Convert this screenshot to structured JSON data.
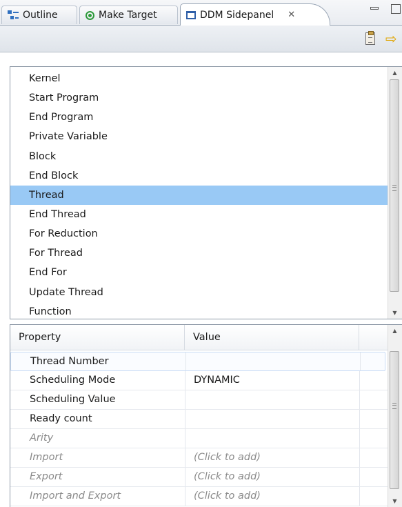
{
  "tabs": [
    {
      "label": "Outline",
      "icon": "outline-icon"
    },
    {
      "label": "Make Target",
      "icon": "make-target-icon"
    },
    {
      "label": "DDM Sidepanel",
      "icon": "panel-icon",
      "close": "✕"
    }
  ],
  "toolbar": {
    "paste_icon": "clipboard-icon",
    "forward_icon": "arrow-right-icon",
    "forward_glyph": "⇨"
  },
  "list": {
    "items": [
      {
        "label": "Kernel"
      },
      {
        "label": "Start Program"
      },
      {
        "label": "End Program"
      },
      {
        "label": "Private Variable"
      },
      {
        "label": "Block"
      },
      {
        "label": "End Block"
      },
      {
        "label": "Thread",
        "selected": true
      },
      {
        "label": "End Thread"
      },
      {
        "label": "For Reduction"
      },
      {
        "label": "For Thread"
      },
      {
        "label": "End For"
      },
      {
        "label": "Update Thread"
      },
      {
        "label": "Function"
      }
    ]
  },
  "properties": {
    "columns": [
      "Property",
      "Value"
    ],
    "rows": [
      {
        "name": "Thread Number",
        "value": "",
        "style": "normal",
        "selected": true
      },
      {
        "name": "Scheduling Mode",
        "value": "DYNAMIC",
        "style": "normal"
      },
      {
        "name": "Scheduling Value",
        "value": "",
        "style": "normal"
      },
      {
        "name": "Ready count",
        "value": "",
        "style": "normal"
      },
      {
        "name": "Arity",
        "value": "",
        "style": "muted"
      },
      {
        "name": "Import",
        "value": "(Click to add)",
        "style": "muted"
      },
      {
        "name": "Export",
        "value": "(Click to add)",
        "style": "muted"
      },
      {
        "name": "Import and Export",
        "value": "(Click to add)",
        "style": "muted"
      }
    ]
  },
  "colors": {
    "selection": "#99c9f5",
    "muted_text": "#8a8a8a",
    "arrow": "#e0a400"
  }
}
